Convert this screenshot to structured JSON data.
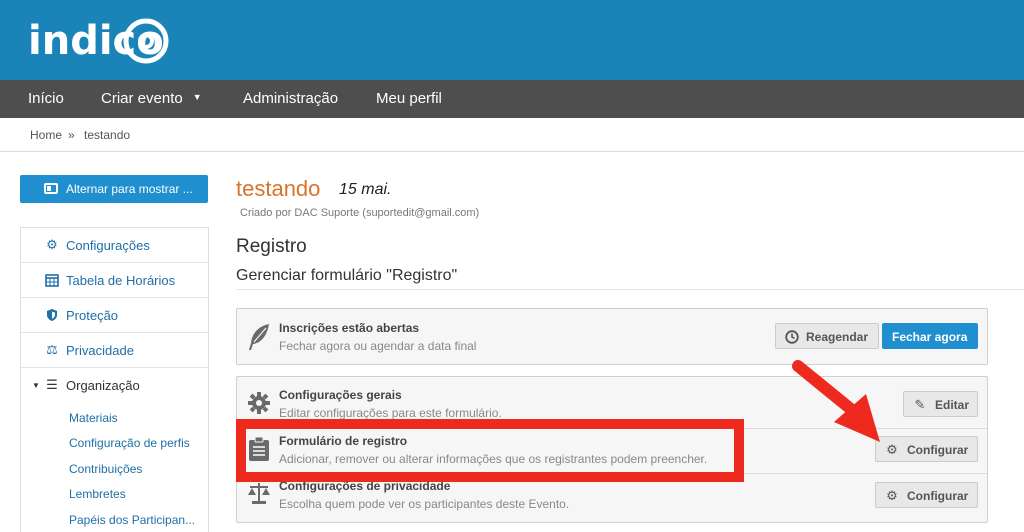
{
  "brand": {
    "logo_text": "indico"
  },
  "nav": {
    "items": [
      {
        "label": "Início"
      },
      {
        "label": "Criar evento",
        "has_dropdown": true
      },
      {
        "label": "Administração"
      },
      {
        "label": "Meu perfil"
      }
    ]
  },
  "breadcrumb": {
    "home": "Home",
    "separator": "»",
    "current": "testando"
  },
  "sidebar": {
    "toggle_label": "Alternar para mostrar ...",
    "items": [
      {
        "label": "Configurações",
        "icon": "gear-icon"
      },
      {
        "label": "Tabela de Horários",
        "icon": "calendar-icon"
      },
      {
        "label": "Proteção",
        "icon": "shield-icon"
      },
      {
        "label": "Privacidade",
        "icon": "scale-icon"
      },
      {
        "label": "Organização",
        "icon": "list-icon",
        "expanded": true
      }
    ],
    "subitems": [
      {
        "label": "Materiais"
      },
      {
        "label": "Configuração de perfis"
      },
      {
        "label": "Contribuições"
      },
      {
        "label": "Lembretes"
      },
      {
        "label": "Papéis dos Participan..."
      }
    ]
  },
  "event": {
    "title": "testando",
    "date": "15 mai.",
    "created_by": "Criado por DAC Suporte (suportedit@gmail.com)"
  },
  "page": {
    "heading": "Registro",
    "subheading": "Gerenciar formulário \"Registro\""
  },
  "status_panel": {
    "title": "Inscrições estão abertas",
    "description": "Fechar agora ou agendar a data final",
    "reschedule_label": "Reagendar",
    "close_now_label": "Fechar agora"
  },
  "settings_rows": [
    {
      "title": "Configurações gerais",
      "description": "Editar configurações para este formulário.",
      "button": "Editar",
      "icon": "gear-icon"
    },
    {
      "title": "Formulário de registro",
      "description": "Adicionar, remover ou alterar informações que os registrantes podem preencher.",
      "button": "Configurar",
      "icon": "clipboard-icon"
    },
    {
      "title": "Configurações de privacidade",
      "description": "Escolha quem pode ver os participantes deste Evento.",
      "button": "Configurar",
      "icon": "scale-icon"
    }
  ],
  "colors": {
    "header": "#1a84b8",
    "nav": "#4e4e4e",
    "accent_blue": "#1f8fd0",
    "event_title": "#d9742a",
    "highlight_red": "#ee2a1f"
  }
}
